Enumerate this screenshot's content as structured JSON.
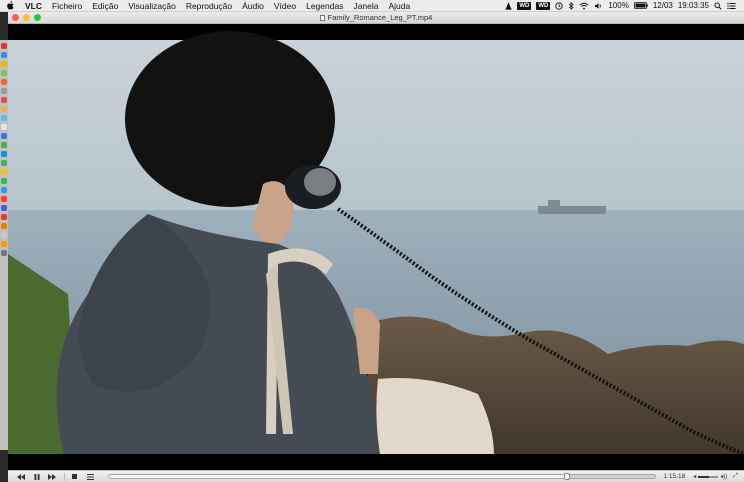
{
  "menubar": {
    "apple_icon": "apple-logo-icon",
    "app_name": "VLC",
    "items": [
      "Ficheiro",
      "Edição",
      "Visualização",
      "Reprodução",
      "Áudio",
      "Vídeo",
      "Legendas",
      "Janela",
      "Ajuda"
    ],
    "tray": {
      "battery": "100%",
      "date": "12/03",
      "time": "19:03:35"
    }
  },
  "window": {
    "title": "Family_Romance_Leg_PT.mp4"
  },
  "controls": {
    "rewind_icon": "rewind-icon",
    "pause_icon": "pause-icon",
    "forward_icon": "fast-forward-icon",
    "stop_icon": "stop-icon",
    "playlist_icon": "playlist-icon",
    "progress": 0.84,
    "time": "1:15:18",
    "volume_level": 0.55
  },
  "colors": {
    "close": "#fc5f57",
    "minimize": "#fdbc2e",
    "maximize": "#28c840"
  }
}
